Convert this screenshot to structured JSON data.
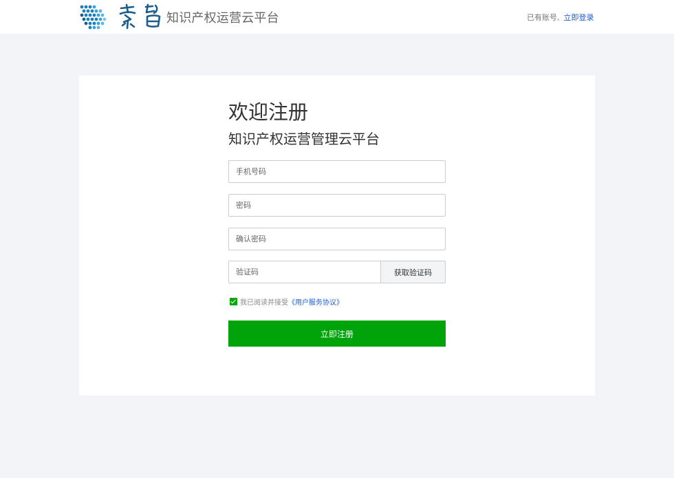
{
  "header": {
    "title": "知识产权运营云平台",
    "has_account_text": "已有账号,",
    "login_link": "立即登录"
  },
  "form": {
    "welcome": "欢迎注册",
    "platform_name": "知识产权运营管理云平台",
    "phone_placeholder": "手机号码",
    "password_placeholder": "密码",
    "confirm_password_placeholder": "确认密码",
    "code_placeholder": "验证码",
    "get_code_button": "获取验证码",
    "agree_text": "我已阅读并接受",
    "agreement_link": "《用户服务协议》",
    "agree_checked": true,
    "submit_button": "立即注册"
  },
  "colors": {
    "brand_green": "#00a40a",
    "link_blue": "#1f5fd1",
    "page_bg": "#f3f4f8"
  },
  "icons": {
    "logo": "dot-grid-logo-icon",
    "brand_calligraphy": "calligraphy-logo-icon"
  }
}
